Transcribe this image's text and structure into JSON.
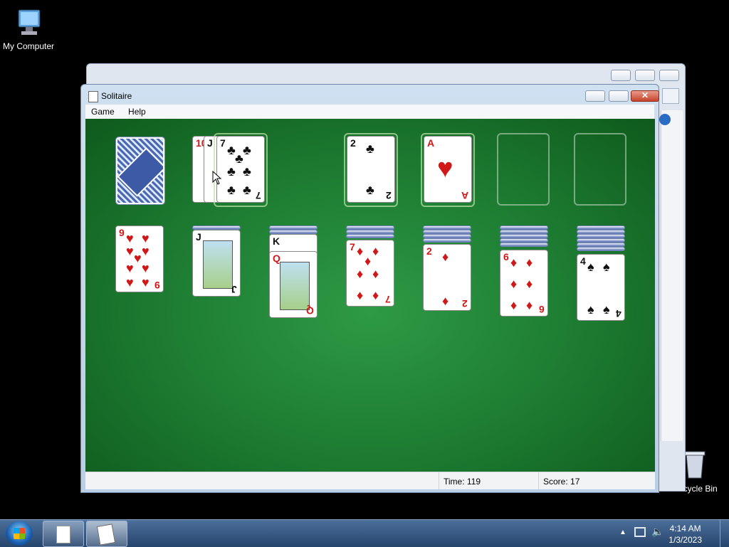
{
  "desktop": {
    "my_computer": "My Computer",
    "recycle_bin": "Recycle Bin"
  },
  "window": {
    "title": "Solitaire"
  },
  "menu": [
    "Game",
    "Help"
  ],
  "status": {
    "time_label": "Time:",
    "time_value": "119",
    "score_label": "Score:",
    "score_value": "17"
  },
  "waste": {
    "cards": [
      "10",
      "J",
      "7"
    ]
  },
  "foundations": [
    {
      "rank": "2",
      "suit": "♣",
      "color": "black"
    },
    {
      "rank": "A",
      "suit": "♥",
      "color": "red"
    }
  ],
  "tableau": [
    {
      "hidden": 0,
      "top": {
        "rank": "9",
        "suit": "♥",
        "color": "red"
      }
    },
    {
      "hidden": 1,
      "top": {
        "rank": "J",
        "suit": "♣",
        "color": "black"
      }
    },
    {
      "hidden": 2,
      "face_ranks": [
        "K",
        "Q"
      ],
      "top": {
        "rank": "Q",
        "suit": "♥",
        "color": "red"
      }
    },
    {
      "hidden": 3,
      "top": {
        "rank": "7",
        "suit": "♦",
        "color": "red"
      }
    },
    {
      "hidden": 4,
      "top": {
        "rank": "2",
        "suit": "♦",
        "color": "red"
      }
    },
    {
      "hidden": 5,
      "top": {
        "rank": "6",
        "suit": "♦",
        "color": "red"
      }
    },
    {
      "hidden": 6,
      "top": {
        "rank": "4",
        "suit": "♠",
        "color": "black"
      }
    }
  ],
  "clock": {
    "time": "4:14 AM",
    "date": "1/3/2023"
  }
}
